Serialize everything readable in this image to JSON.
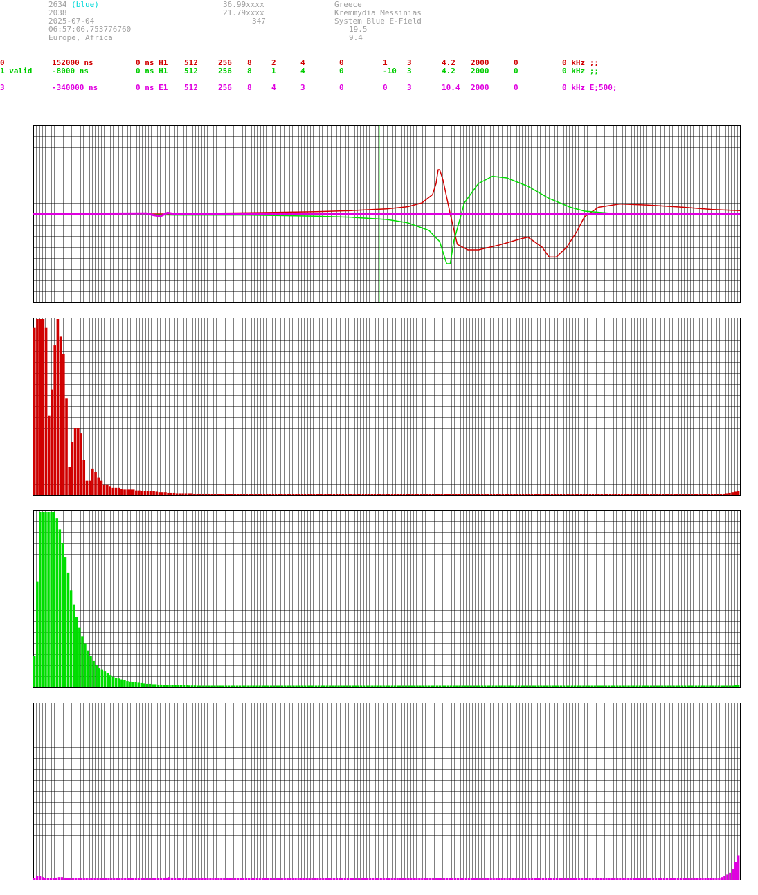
{
  "header": {
    "station_id": "2634",
    "station_tag": "(blue)",
    "count": "2038",
    "date": "2025-07-04",
    "time": "06:57:06.753776760",
    "region": "Europe, Africa",
    "lat": "36.99xxxx",
    "lon": "21.79xxxx",
    "alt": "347",
    "country": "Greece",
    "place": "Kremmydia Messinias",
    "system": "System Blue E-Field",
    "val1": "19.5",
    "val2": "9.4"
  },
  "channels": [
    {
      "color": "#d00000",
      "cells": [
        "0",
        "152000 ns",
        "0 ns H1",
        "512",
        "256",
        "8",
        "2",
        "4",
        "0",
        "1",
        "3",
        "4.2",
        "2000",
        "0",
        "0 kHz ;;"
      ]
    },
    {
      "color": "#00cc00",
      "cells": [
        "1 valid",
        "-8000 ns",
        "0 ns H1",
        "512",
        "256",
        "8",
        "1",
        "4",
        "0",
        "-10",
        "3",
        "4.2",
        "2000",
        "0",
        "0 kHz ;;"
      ]
    },
    {
      "color": "#e000e0",
      "cells": [
        "3",
        "-340000 ns",
        "0 ns E1",
        "512",
        "256",
        "8",
        "4",
        "3",
        "0",
        "0",
        "3",
        "10.4",
        "2000",
        "0",
        "0 kHz E;500;"
      ]
    }
  ],
  "colors": {
    "red": "#d00000",
    "green": "#00dd00",
    "magenta": "#e000e0",
    "grid": "#000000"
  },
  "chart_data": [
    {
      "type": "line",
      "markers": [
        {
          "color": "#e000e0",
          "x": 0.165
        },
        {
          "color": "#00dd00",
          "x": 0.49
        },
        {
          "color": "#d00000",
          "x": 0.645
        }
      ],
      "series": [
        {
          "color": "#d00000",
          "points": [
            [
              0,
              0
            ],
            [
              0.1,
              0
            ],
            [
              0.2,
              0
            ],
            [
              0.22,
              0.01
            ],
            [
              0.3,
              0.02
            ],
            [
              0.4,
              0.04
            ],
            [
              0.45,
              0.06
            ],
            [
              0.5,
              0.09
            ],
            [
              0.53,
              0.13
            ],
            [
              0.55,
              0.2
            ],
            [
              0.565,
              0.35
            ],
            [
              0.57,
              0.55
            ],
            [
              0.573,
              0.8
            ],
            [
              0.575,
              0.8
            ],
            [
              0.58,
              0.6
            ],
            [
              0.59,
              0.0
            ],
            [
              0.6,
              -0.55
            ],
            [
              0.615,
              -0.65
            ],
            [
              0.63,
              -0.65
            ],
            [
              0.66,
              -0.56
            ],
            [
              0.69,
              -0.45
            ],
            [
              0.7,
              -0.42
            ],
            [
              0.72,
              -0.6
            ],
            [
              0.73,
              -0.78
            ],
            [
              0.74,
              -0.78
            ],
            [
              0.755,
              -0.6
            ],
            [
              0.77,
              -0.3
            ],
            [
              0.78,
              -0.05
            ],
            [
              0.8,
              0.12
            ],
            [
              0.83,
              0.18
            ],
            [
              0.87,
              0.16
            ],
            [
              0.92,
              0.12
            ],
            [
              0.96,
              0.08
            ],
            [
              1.0,
              0.06
            ]
          ]
        },
        {
          "color": "#00dd00",
          "points": [
            [
              0,
              0
            ],
            [
              0.08,
              0.01
            ],
            [
              0.12,
              0
            ],
            [
              0.2,
              -0.02
            ],
            [
              0.3,
              -0.02
            ],
            [
              0.4,
              -0.04
            ],
            [
              0.45,
              -0.06
            ],
            [
              0.5,
              -0.1
            ],
            [
              0.53,
              -0.16
            ],
            [
              0.56,
              -0.3
            ],
            [
              0.575,
              -0.5
            ],
            [
              0.585,
              -0.9
            ],
            [
              0.59,
              -0.9
            ],
            [
              0.595,
              -0.5
            ],
            [
              0.61,
              0.2
            ],
            [
              0.63,
              0.55
            ],
            [
              0.65,
              0.68
            ],
            [
              0.67,
              0.65
            ],
            [
              0.7,
              0.5
            ],
            [
              0.73,
              0.28
            ],
            [
              0.76,
              0.12
            ],
            [
              0.78,
              0.05
            ],
            [
              0.82,
              0.01
            ],
            [
              0.9,
              0
            ],
            [
              1.0,
              0
            ]
          ]
        },
        {
          "color": "#e000e0",
          "points": [
            [
              0,
              0
            ],
            [
              0.16,
              0.01
            ],
            [
              0.17,
              -0.02
            ],
            [
              0.18,
              -0.04
            ],
            [
              0.19,
              0.02
            ],
            [
              0.2,
              0
            ],
            [
              1.0,
              0
            ]
          ]
        }
      ]
    },
    {
      "type": "bar",
      "color": "#d00000",
      "values": [
        0.95,
        1.0,
        1.0,
        1.0,
        0.95,
        0.45,
        0.6,
        0.85,
        1.0,
        0.9,
        0.8,
        0.55,
        0.16,
        0.3,
        0.38,
        0.38,
        0.35,
        0.2,
        0.08,
        0.08,
        0.15,
        0.13,
        0.1,
        0.08,
        0.06,
        0.06,
        0.05,
        0.04,
        0.04,
        0.04,
        0.035,
        0.03,
        0.03,
        0.03,
        0.03,
        0.025,
        0.025,
        0.02,
        0.02,
        0.02,
        0.02,
        0.02,
        0.018,
        0.015,
        0.015,
        0.015,
        0.012,
        0.012,
        0.012,
        0.01,
        0.01,
        0.01,
        0.01,
        0.01,
        0.01,
        0.008,
        0.008,
        0.008,
        0.008,
        0.008,
        0.008,
        0.006,
        0.006,
        0.006,
        0.006,
        0.006,
        0.006,
        0.006,
        0.006,
        0.006,
        0.006,
        0.006,
        0.006,
        0.006,
        0.006,
        0.006,
        0.006,
        0.006,
        0.006,
        0.006,
        0.006,
        0.006,
        0.006,
        0.006,
        0.006,
        0.006,
        0.006,
        0.006,
        0.006,
        0.006,
        0.006,
        0.006,
        0.006,
        0.006,
        0.006,
        0.006,
        0.006,
        0.006,
        0.006,
        0.006,
        0.006,
        0.006,
        0.006,
        0.006,
        0.006,
        0.006,
        0.006,
        0.006,
        0.006,
        0.006,
        0.006,
        0.006,
        0.006,
        0.006,
        0.006,
        0.006,
        0.006,
        0.006,
        0.006,
        0.006,
        0.006,
        0.006,
        0.006,
        0.006,
        0.006,
        0.006,
        0.006,
        0.006,
        0.006,
        0.006,
        0.006,
        0.006,
        0.006,
        0.006,
        0.006,
        0.006,
        0.006,
        0.006,
        0.006,
        0.006,
        0.006,
        0.006,
        0.006,
        0.006,
        0.006,
        0.006,
        0.006,
        0.006,
        0.006,
        0.006,
        0.006,
        0.006,
        0.006,
        0.006,
        0.006,
        0.006,
        0.006,
        0.006,
        0.006,
        0.006,
        0.006,
        0.006,
        0.006,
        0.006,
        0.006,
        0.006,
        0.006,
        0.006,
        0.006,
        0.006,
        0.006,
        0.006,
        0.006,
        0.006,
        0.006,
        0.006,
        0.006,
        0.006,
        0.006,
        0.006,
        0.006,
        0.006,
        0.006,
        0.006,
        0.006,
        0.006,
        0.006,
        0.006,
        0.006,
        0.006,
        0.006,
        0.006,
        0.006,
        0.006,
        0.006,
        0.006,
        0.006,
        0.006,
        0.006,
        0.006,
        0.006,
        0.006,
        0.006,
        0.006,
        0.006,
        0.006,
        0.006,
        0.006,
        0.006,
        0.006,
        0.006,
        0.006,
        0.006,
        0.006,
        0.006,
        0.006,
        0.006,
        0.006,
        0.006,
        0.006,
        0.006,
        0.006,
        0.006,
        0.006,
        0.006,
        0.006,
        0.006,
        0.006,
        0.006,
        0.006,
        0.006,
        0.006,
        0.006,
        0.006,
        0.006,
        0.006,
        0.006,
        0.008,
        0.01,
        0.012,
        0.015,
        0.018,
        0.02
      ]
    },
    {
      "type": "bar",
      "color": "#00dd00",
      "values": [
        0.18,
        0.6,
        1.0,
        1.0,
        1.0,
        1.0,
        1.0,
        1.0,
        0.96,
        0.9,
        0.82,
        0.74,
        0.65,
        0.55,
        0.47,
        0.4,
        0.34,
        0.29,
        0.25,
        0.21,
        0.18,
        0.15,
        0.13,
        0.11,
        0.1,
        0.09,
        0.08,
        0.07,
        0.06,
        0.055,
        0.05,
        0.045,
        0.04,
        0.035,
        0.032,
        0.03,
        0.028,
        0.026,
        0.024,
        0.022,
        0.02,
        0.02,
        0.018,
        0.018,
        0.016,
        0.016,
        0.015,
        0.015,
        0.014,
        0.014,
        0.013,
        0.013,
        0.012,
        0.012,
        0.012,
        0.011,
        0.011,
        0.011,
        0.01,
        0.01,
        0.01,
        0.01,
        0.01,
        0.01,
        0.01,
        0.01,
        0.01,
        0.01,
        0.01,
        0.01,
        0.01,
        0.01,
        0.01,
        0.01,
        0.01,
        0.01,
        0.01,
        0.01,
        0.01,
        0.01,
        0.01,
        0.01,
        0.01,
        0.01,
        0.01,
        0.01,
        0.01,
        0.01,
        0.01,
        0.01,
        0.01,
        0.01,
        0.01,
        0.01,
        0.01,
        0.01,
        0.01,
        0.01,
        0.01,
        0.01,
        0.01,
        0.01,
        0.01,
        0.01,
        0.01,
        0.01,
        0.01,
        0.01,
        0.01,
        0.01,
        0.01,
        0.01,
        0.01,
        0.01,
        0.01,
        0.01,
        0.01,
        0.01,
        0.01,
        0.01,
        0.01,
        0.01,
        0.01,
        0.01,
        0.01,
        0.01,
        0.01,
        0.01,
        0.01,
        0.01,
        0.01,
        0.01,
        0.01,
        0.01,
        0.01,
        0.01,
        0.01,
        0.01,
        0.01,
        0.01,
        0.01,
        0.01,
        0.01,
        0.01,
        0.01,
        0.01,
        0.01,
        0.01,
        0.01,
        0.01,
        0.01,
        0.01,
        0.01,
        0.01,
        0.01,
        0.01,
        0.01,
        0.01,
        0.01,
        0.01,
        0.01,
        0.01,
        0.01,
        0.01,
        0.01,
        0.01,
        0.01,
        0.01,
        0.01,
        0.01,
        0.01,
        0.01,
        0.01,
        0.01,
        0.01,
        0.01,
        0.01,
        0.01,
        0.01,
        0.01,
        0.01,
        0.01,
        0.01,
        0.01,
        0.01,
        0.01,
        0.01,
        0.01,
        0.01,
        0.01,
        0.01,
        0.01,
        0.01,
        0.01,
        0.01,
        0.01,
        0.01,
        0.01,
        0.01,
        0.01,
        0.01,
        0.01,
        0.01,
        0.01,
        0.01,
        0.01,
        0.01,
        0.01,
        0.01,
        0.01,
        0.01,
        0.01,
        0.01,
        0.01,
        0.01,
        0.01,
        0.01,
        0.01,
        0.01,
        0.01,
        0.01,
        0.01,
        0.01,
        0.01,
        0.01,
        0.01,
        0.01,
        0.01,
        0.01,
        0.01,
        0.01,
        0.01,
        0.01,
        0.01,
        0.01,
        0.01,
        0.01,
        0.01,
        0.01,
        0.01,
        0.01,
        0.01,
        0.01,
        0.01,
        0.01,
        0.01,
        0.01,
        0.01,
        0.01,
        0.012,
        0.015
      ]
    },
    {
      "type": "bar",
      "color": "#e000e0",
      "values": [
        0.01,
        0.02,
        0.02,
        0.015,
        0.01,
        0.01,
        0.008,
        0.01,
        0.012,
        0.015,
        0.015,
        0.012,
        0.01,
        0.008,
        0.008,
        0.008,
        0.008,
        0.008,
        0.008,
        0.008,
        0.008,
        0.008,
        0.008,
        0.008,
        0.008,
        0.008,
        0.008,
        0.008,
        0.008,
        0.008,
        0.008,
        0.008,
        0.008,
        0.008,
        0.008,
        0.008,
        0.008,
        0.008,
        0.008,
        0.008,
        0.008,
        0.008,
        0.008,
        0.008,
        0.008,
        0.008,
        0.008,
        0.008,
        0.012,
        0.015,
        0.012,
        0.008,
        0.008,
        0.008,
        0.008,
        0.008,
        0.008,
        0.008,
        0.008,
        0.008,
        0.008,
        0.008,
        0.008,
        0.008,
        0.008,
        0.008,
        0.008,
        0.008,
        0.008,
        0.008,
        0.008,
        0.008,
        0.008,
        0.008,
        0.008,
        0.008,
        0.008,
        0.008,
        0.008,
        0.008,
        0.008,
        0.008,
        0.008,
        0.008,
        0.008,
        0.008,
        0.008,
        0.008,
        0.008,
        0.008,
        0.008,
        0.008,
        0.008,
        0.008,
        0.008,
        0.008,
        0.008,
        0.008,
        0.008,
        0.008,
        0.008,
        0.008,
        0.008,
        0.008,
        0.008,
        0.008,
        0.008,
        0.008,
        0.008,
        0.008,
        0.008,
        0.008,
        0.008,
        0.008,
        0.008,
        0.008,
        0.008,
        0.008,
        0.008,
        0.008,
        0.008,
        0.008,
        0.008,
        0.008,
        0.008,
        0.008,
        0.008,
        0.008,
        0.008,
        0.008,
        0.008,
        0.008,
        0.008,
        0.008,
        0.008,
        0.008,
        0.008,
        0.008,
        0.008,
        0.008,
        0.008,
        0.008,
        0.008,
        0.008,
        0.008,
        0.008,
        0.008,
        0.008,
        0.008,
        0.008,
        0.008,
        0.008,
        0.008,
        0.008,
        0.008,
        0.008,
        0.008,
        0.008,
        0.008,
        0.008,
        0.008,
        0.008,
        0.008,
        0.008,
        0.008,
        0.008,
        0.008,
        0.008,
        0.008,
        0.008,
        0.008,
        0.008,
        0.008,
        0.008,
        0.008,
        0.008,
        0.008,
        0.008,
        0.008,
        0.008,
        0.008,
        0.008,
        0.008,
        0.008,
        0.008,
        0.008,
        0.008,
        0.008,
        0.008,
        0.008,
        0.008,
        0.008,
        0.008,
        0.008,
        0.008,
        0.008,
        0.008,
        0.008,
        0.008,
        0.008,
        0.008,
        0.008,
        0.008,
        0.008,
        0.008,
        0.008,
        0.008,
        0.008,
        0.008,
        0.008,
        0.008,
        0.008,
        0.008,
        0.008,
        0.008,
        0.008,
        0.008,
        0.008,
        0.008,
        0.008,
        0.008,
        0.008,
        0.008,
        0.008,
        0.008,
        0.008,
        0.008,
        0.008,
        0.008,
        0.008,
        0.008,
        0.008,
        0.008,
        0.008,
        0.008,
        0.008,
        0.008,
        0.008,
        0.008,
        0.008,
        0.008,
        0.008,
        0.008,
        0.008,
        0.008,
        0.008,
        0.008,
        0.008,
        0.008,
        0.01,
        0.015,
        0.02,
        0.03,
        0.04,
        0.06,
        0.1,
        0.14
      ]
    }
  ]
}
